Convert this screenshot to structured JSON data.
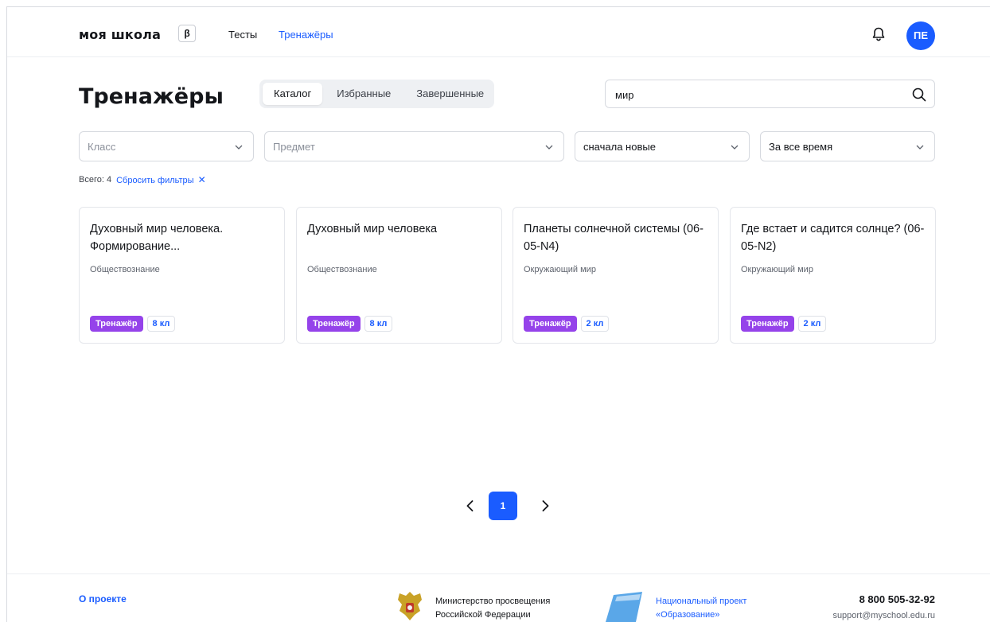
{
  "header": {
    "logo": "моя школа",
    "beta": "β",
    "nav": [
      {
        "label": "Тесты",
        "active": false
      },
      {
        "label": "Тренажёры",
        "active": true
      }
    ],
    "avatar_initials": "ПЕ",
    "accent": "#1a5cff"
  },
  "page": {
    "title": "Тренажёры",
    "tabs": [
      {
        "label": "Каталог",
        "active": true
      },
      {
        "label": "Избранные",
        "active": false
      },
      {
        "label": "Завершенные",
        "active": false
      }
    ],
    "search": {
      "value": "мир",
      "placeholder": ""
    }
  },
  "filters": {
    "class": {
      "value": "",
      "placeholder": "Класс"
    },
    "subject": {
      "value": "",
      "placeholder": "Предмет"
    },
    "sort": {
      "value": "сначала новые"
    },
    "period": {
      "value": "За все время"
    }
  },
  "results": {
    "total_label": "Всего: 4",
    "reset_label": "Сбросить фильтры",
    "reset_icon": "✕"
  },
  "cards": [
    {
      "title": "Духовный мир человека. Формирование...",
      "subject": "Обществознание",
      "type": "Тренажёр",
      "grade": "8 кл"
    },
    {
      "title": "Духовный мир человека",
      "subject": "Обществознание",
      "type": "Тренажёр",
      "grade": "8 кл"
    },
    {
      "title": "Планеты солнечной системы (06-05-N4)",
      "subject": "Окружающий мир",
      "type": "Тренажёр",
      "grade": "2 кл"
    },
    {
      "title": "Где встает и садится солнце? (06-05-N2)",
      "subject": "Окружающий мир",
      "type": "Тренажёр",
      "grade": "2 кл"
    }
  ],
  "pagination": {
    "current": "1"
  },
  "footer": {
    "about": "О проекте",
    "ministry_line1": "Министерство просвещения",
    "ministry_line2": "Российской Федерации",
    "project_line1": "Национальный проект",
    "project_line2": "«Образование»",
    "phone": "8 800 505-32-92",
    "email": "support@myschool.edu.ru"
  },
  "colors": {
    "badge_type": "#9543ea",
    "primary": "#1a5cff"
  }
}
